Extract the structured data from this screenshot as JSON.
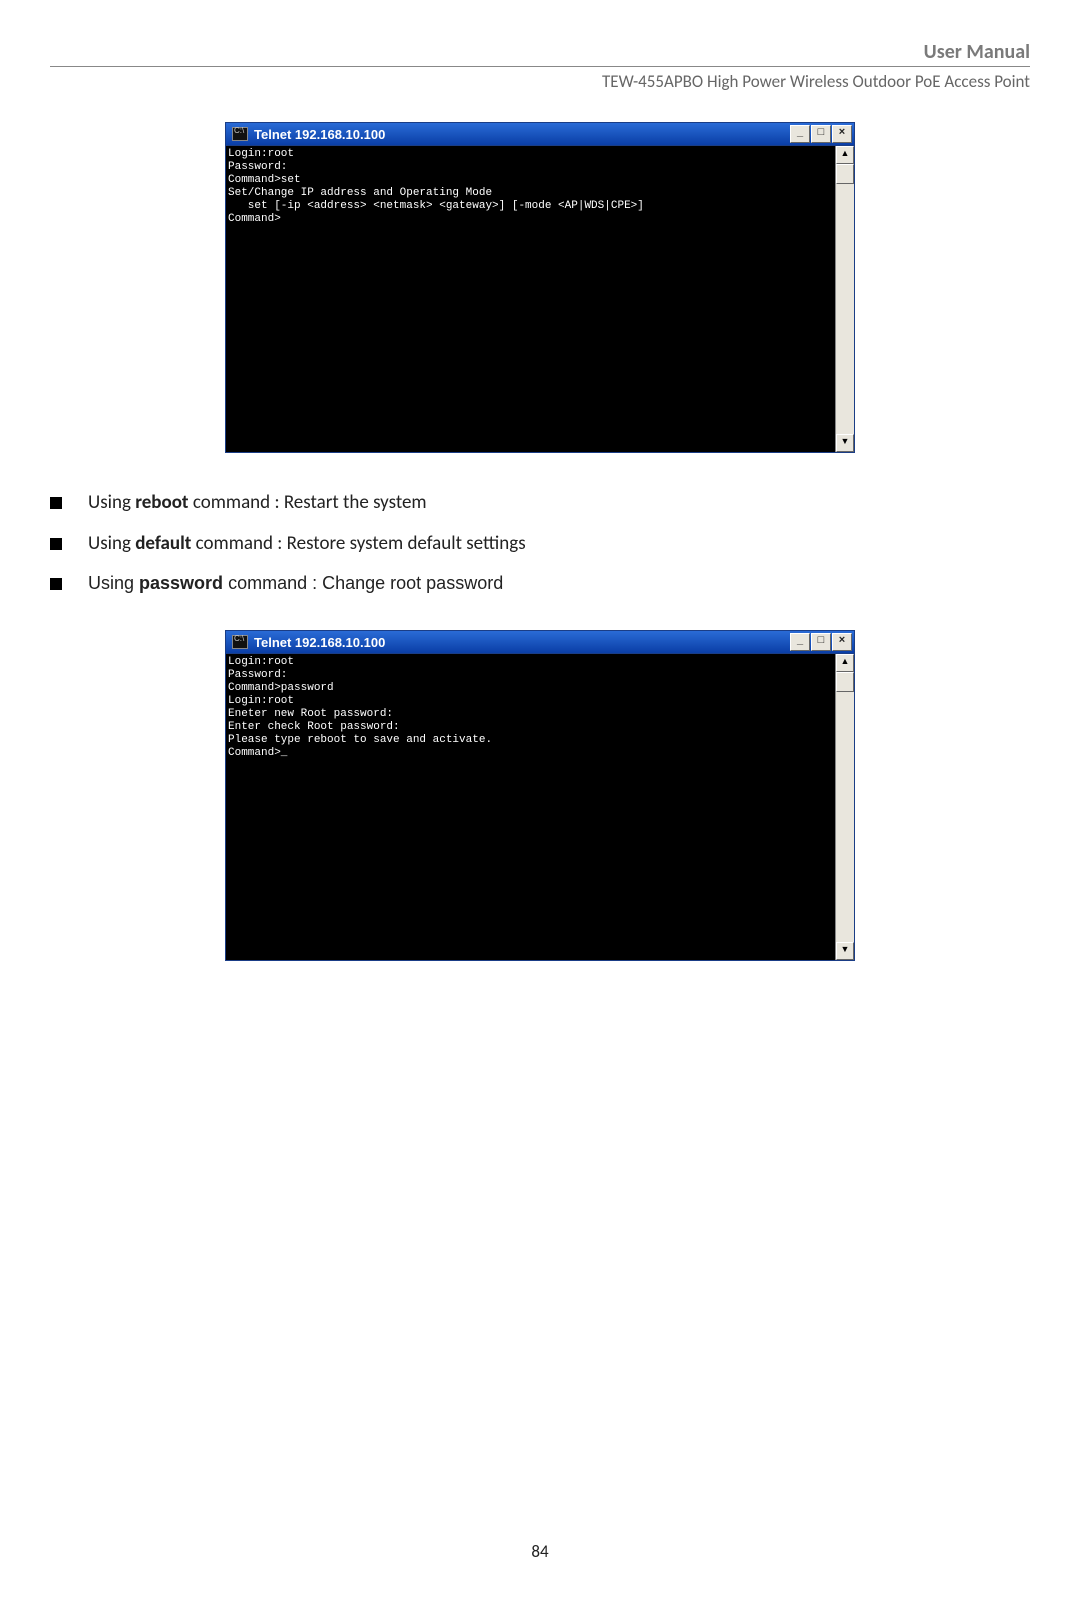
{
  "header": {
    "title": "User Manual",
    "subtitle": "TEW-455APBO High Power Wireless Outdoor PoE Access Point"
  },
  "terminal1": {
    "title": "Telnet 192.168.10.100",
    "content": "Login:root\nPassword:\nCommand>set\nSet/Change IP address and Operating Mode\n   set [-ip <address> <netmask> <gateway>] [-mode <AP|WDS|CPE>]\nCommand>"
  },
  "bullets": {
    "b1_pre": "Using ",
    "b1_cmd": "reboot",
    "b1_post": " command : Restart the system",
    "b2_pre": "Using ",
    "b2_cmd": "default",
    "b2_post": " command : Restore system default settings",
    "b3_pre": "Using ",
    "b3_cmd": "password",
    "b3_post": " command : Change root password"
  },
  "terminal2": {
    "title": "Telnet 192.168.10.100",
    "content": "Login:root\nPassword:\nCommand>password\nLogin:root\nEneter new Root password:\nEnter check Root password:\nPlease type reboot to save and activate.\nCommand>_"
  },
  "page_number": "84",
  "win_controls": {
    "min": "_",
    "max": "□",
    "close": "×"
  },
  "scroll": {
    "up": "▲",
    "down": "▼"
  }
}
